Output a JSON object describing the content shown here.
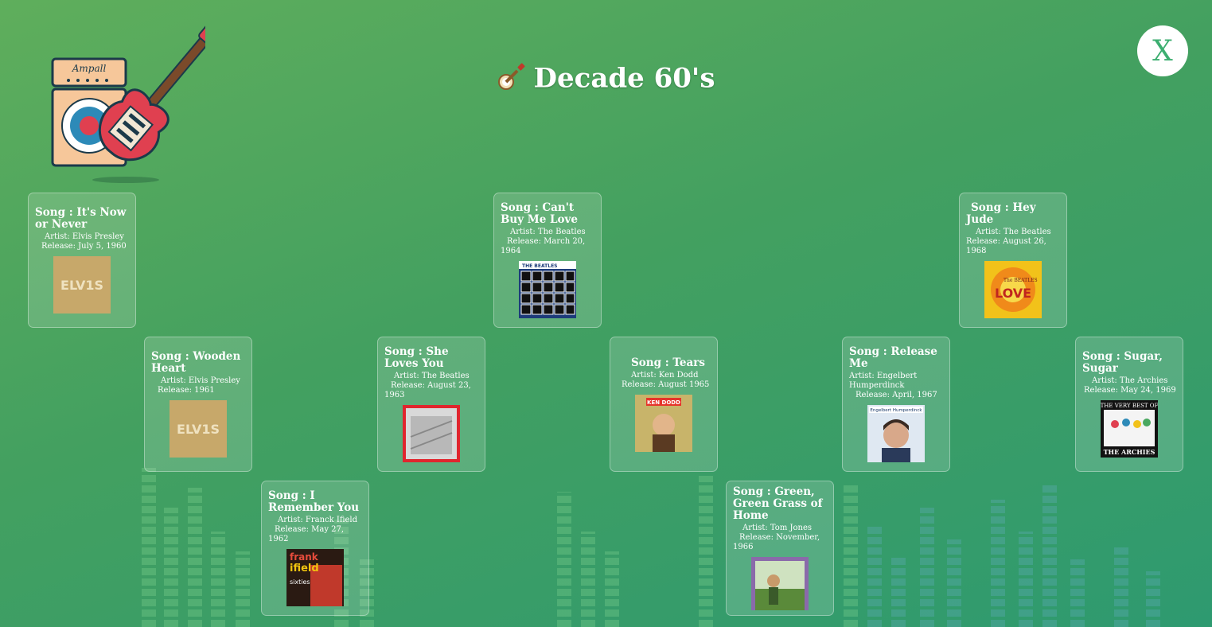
{
  "header": {
    "title": "Decade 60's",
    "close_label": "X"
  },
  "logo": {
    "brand_text": "Ampall"
  },
  "songs": [
    {
      "title": "Song : It's Now or Never",
      "artist": "Artist: Elvis Presley",
      "release": "Release: July 5, 1960",
      "cover": "elvis"
    },
    {
      "title": "Song : Wooden Heart",
      "artist": "Artist: Elvis Presley",
      "release": "Release: 1961",
      "cover": "elvis"
    },
    {
      "title": "Song : I Remember You",
      "artist": "Artist: Franck Ifield",
      "release": "Release: May 27, 1962",
      "cover": "ifield"
    },
    {
      "title": "Song : She Loves You",
      "artist": "Artist: The Beatles",
      "release": "Release: August 23, 1963",
      "cover": "red"
    },
    {
      "title": "Song : Can't Buy Me Love",
      "artist": "Artist: The Beatles",
      "release": "Release: March 20, 1964",
      "cover": "hardday"
    },
    {
      "title": "Song : Tears",
      "artist": "Artist: Ken Dodd",
      "release": "Release: August 1965",
      "cover": "dodd"
    },
    {
      "title": "Song : Green, Green Grass of Home",
      "artist": "Artist: Tom Jones",
      "release": "Release: November, 1966",
      "cover": "jones"
    },
    {
      "title": "Song : Release Me",
      "artist": "Artist: Engelbert Humperdinck",
      "release": "Release: April, 1967",
      "cover": "engelbert"
    },
    {
      "title": "Song : Hey Jude",
      "artist": "Artist: The Beatles",
      "release": "Release: August 26, 1968",
      "cover": "love"
    },
    {
      "title": "Song : Sugar, Sugar",
      "artist": "Artist: The Archies",
      "release": "Release: May 24, 1969",
      "cover": "archies"
    }
  ],
  "cover_text": {
    "elvis": "ELV1S",
    "ifield_1": "frank",
    "ifield_2": "ifield",
    "ifield_3": "sixties",
    "hardday": "THE BEATLES",
    "dodd": "KEN DODD",
    "engelbert": "Engelbert Humperdinck",
    "love_1": "The BEATLES",
    "love_2": "LOVE",
    "archies_1": "THE VERY BEST OF",
    "archies_2": "THE ARCHIES"
  }
}
